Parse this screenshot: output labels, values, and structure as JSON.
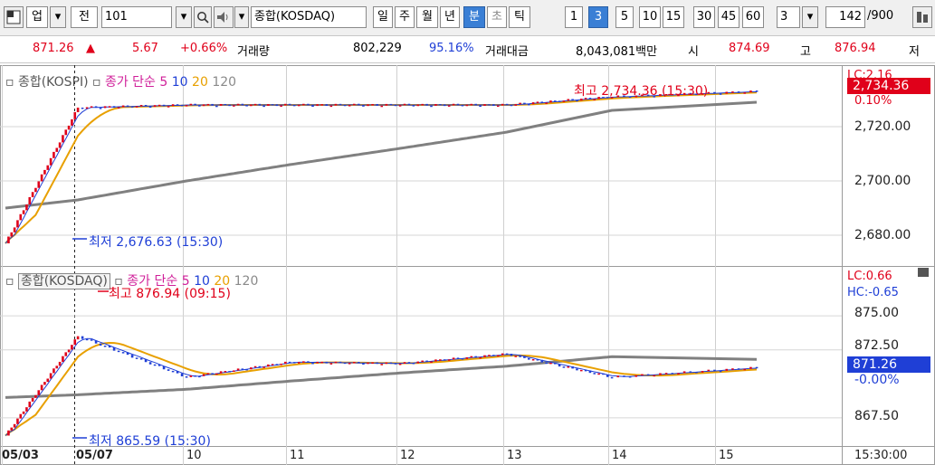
{
  "toolbar": {
    "market": "업",
    "kind": "전",
    "code": "101",
    "index_name": "종합(KOSDAQ)",
    "periods": [
      "일",
      "주",
      "월",
      "년",
      "분",
      "초",
      "틱"
    ],
    "selected_period": "분",
    "intervals": [
      "1",
      "3",
      "5",
      "10",
      "15",
      "30",
      "45",
      "60"
    ],
    "selected_interval": "3",
    "interval_value": "3",
    "count": "142",
    "count_total": "/900"
  },
  "quote": {
    "price": "871.26",
    "change_arrow": "▲",
    "change": "5.67",
    "change_pct": "+0.66%",
    "volume_label": "거래량",
    "volume": "802,229",
    "volume_ratio": "95.16%",
    "amount_label": "거래대금",
    "amount": "8,043,081백만",
    "open_label": "시",
    "open": "874.69",
    "high_label": "고",
    "high": "876.94",
    "low_label": "저"
  },
  "upper_panel": {
    "legend_index": "종합(KOSPI)",
    "legend_ma_label": "종가 단순",
    "legend_ma_periods": [
      "5",
      "10",
      "20",
      "120"
    ],
    "max_label": "최고 2,734.36 (15:30)",
    "min_label": "최저 2,676.63 (15:30)",
    "lc_label": "LC:2.16",
    "pct_label": "0.10%",
    "current_price": "2,734.36",
    "yticks": [
      "2,720.00",
      "2,700.00",
      "2,680.00"
    ]
  },
  "lower_panel": {
    "legend_index": "종합(KOSDAQ)",
    "legend_ma_label": "종가 단순",
    "legend_ma_periods": [
      "5",
      "10",
      "20",
      "120"
    ],
    "max_label": "최고 876.94 (09:15)",
    "min_label": "최저 865.59 (15:30)",
    "lc_label": "LC:0.66",
    "hc_label": "HC:-0.65",
    "current_price": "871.26",
    "current_pct": "-0.00%",
    "yticks": [
      "875.00",
      "872.50",
      "867.50"
    ]
  },
  "xaxis": {
    "labels": [
      "05/03",
      "05/07",
      "10",
      "11",
      "12",
      "13",
      "14",
      "15"
    ],
    "time_label": "15:30:00"
  },
  "colors": {
    "up": "#e0001a",
    "down": "#1f3fd6",
    "ma5": "#d0209a",
    "ma10": "#1f3fd6",
    "ma20": "#e8a000",
    "ma120": "#808080",
    "selected": "#3a7fd5"
  },
  "icons": [
    "chart-type-icon",
    "dropdown-arrow-icon",
    "search-icon",
    "speaker-icon",
    "menu-icon"
  ],
  "chart_data": [
    {
      "type": "line",
      "title": "종합(KOSPI)",
      "x": [
        "05/03",
        "05/07",
        "10",
        "11",
        "12",
        "13",
        "14",
        "15"
      ],
      "series": [
        {
          "name": "종합(KOSPI)",
          "values": [
            2677,
            2727,
            2728,
            2728,
            2728,
            2728,
            2731,
            2733
          ]
        },
        {
          "name": "120",
          "values": [
            2690,
            2693,
            2700,
            2706,
            2712,
            2718,
            2726,
            2729
          ]
        }
      ],
      "ylim": [
        2670,
        2740
      ],
      "ylabel": "",
      "xlabel": ""
    },
    {
      "type": "line",
      "title": "종합(KOSDAQ)",
      "x": [
        "05/03",
        "05/07",
        "10",
        "11",
        "12",
        "13",
        "14",
        "15"
      ],
      "series": [
        {
          "name": "종합(KOSDAQ)",
          "values": [
            866.2,
            873.5,
            870.5,
            871.6,
            871.5,
            872.2,
            870.5,
            871.2
          ]
        },
        {
          "name": "120",
          "values": [
            869.0,
            869.2,
            869.6,
            870.2,
            870.8,
            871.3,
            872.0,
            871.8
          ]
        }
      ],
      "ylim": [
        865.5,
        878
      ],
      "ylabel": "",
      "xlabel": ""
    }
  ]
}
